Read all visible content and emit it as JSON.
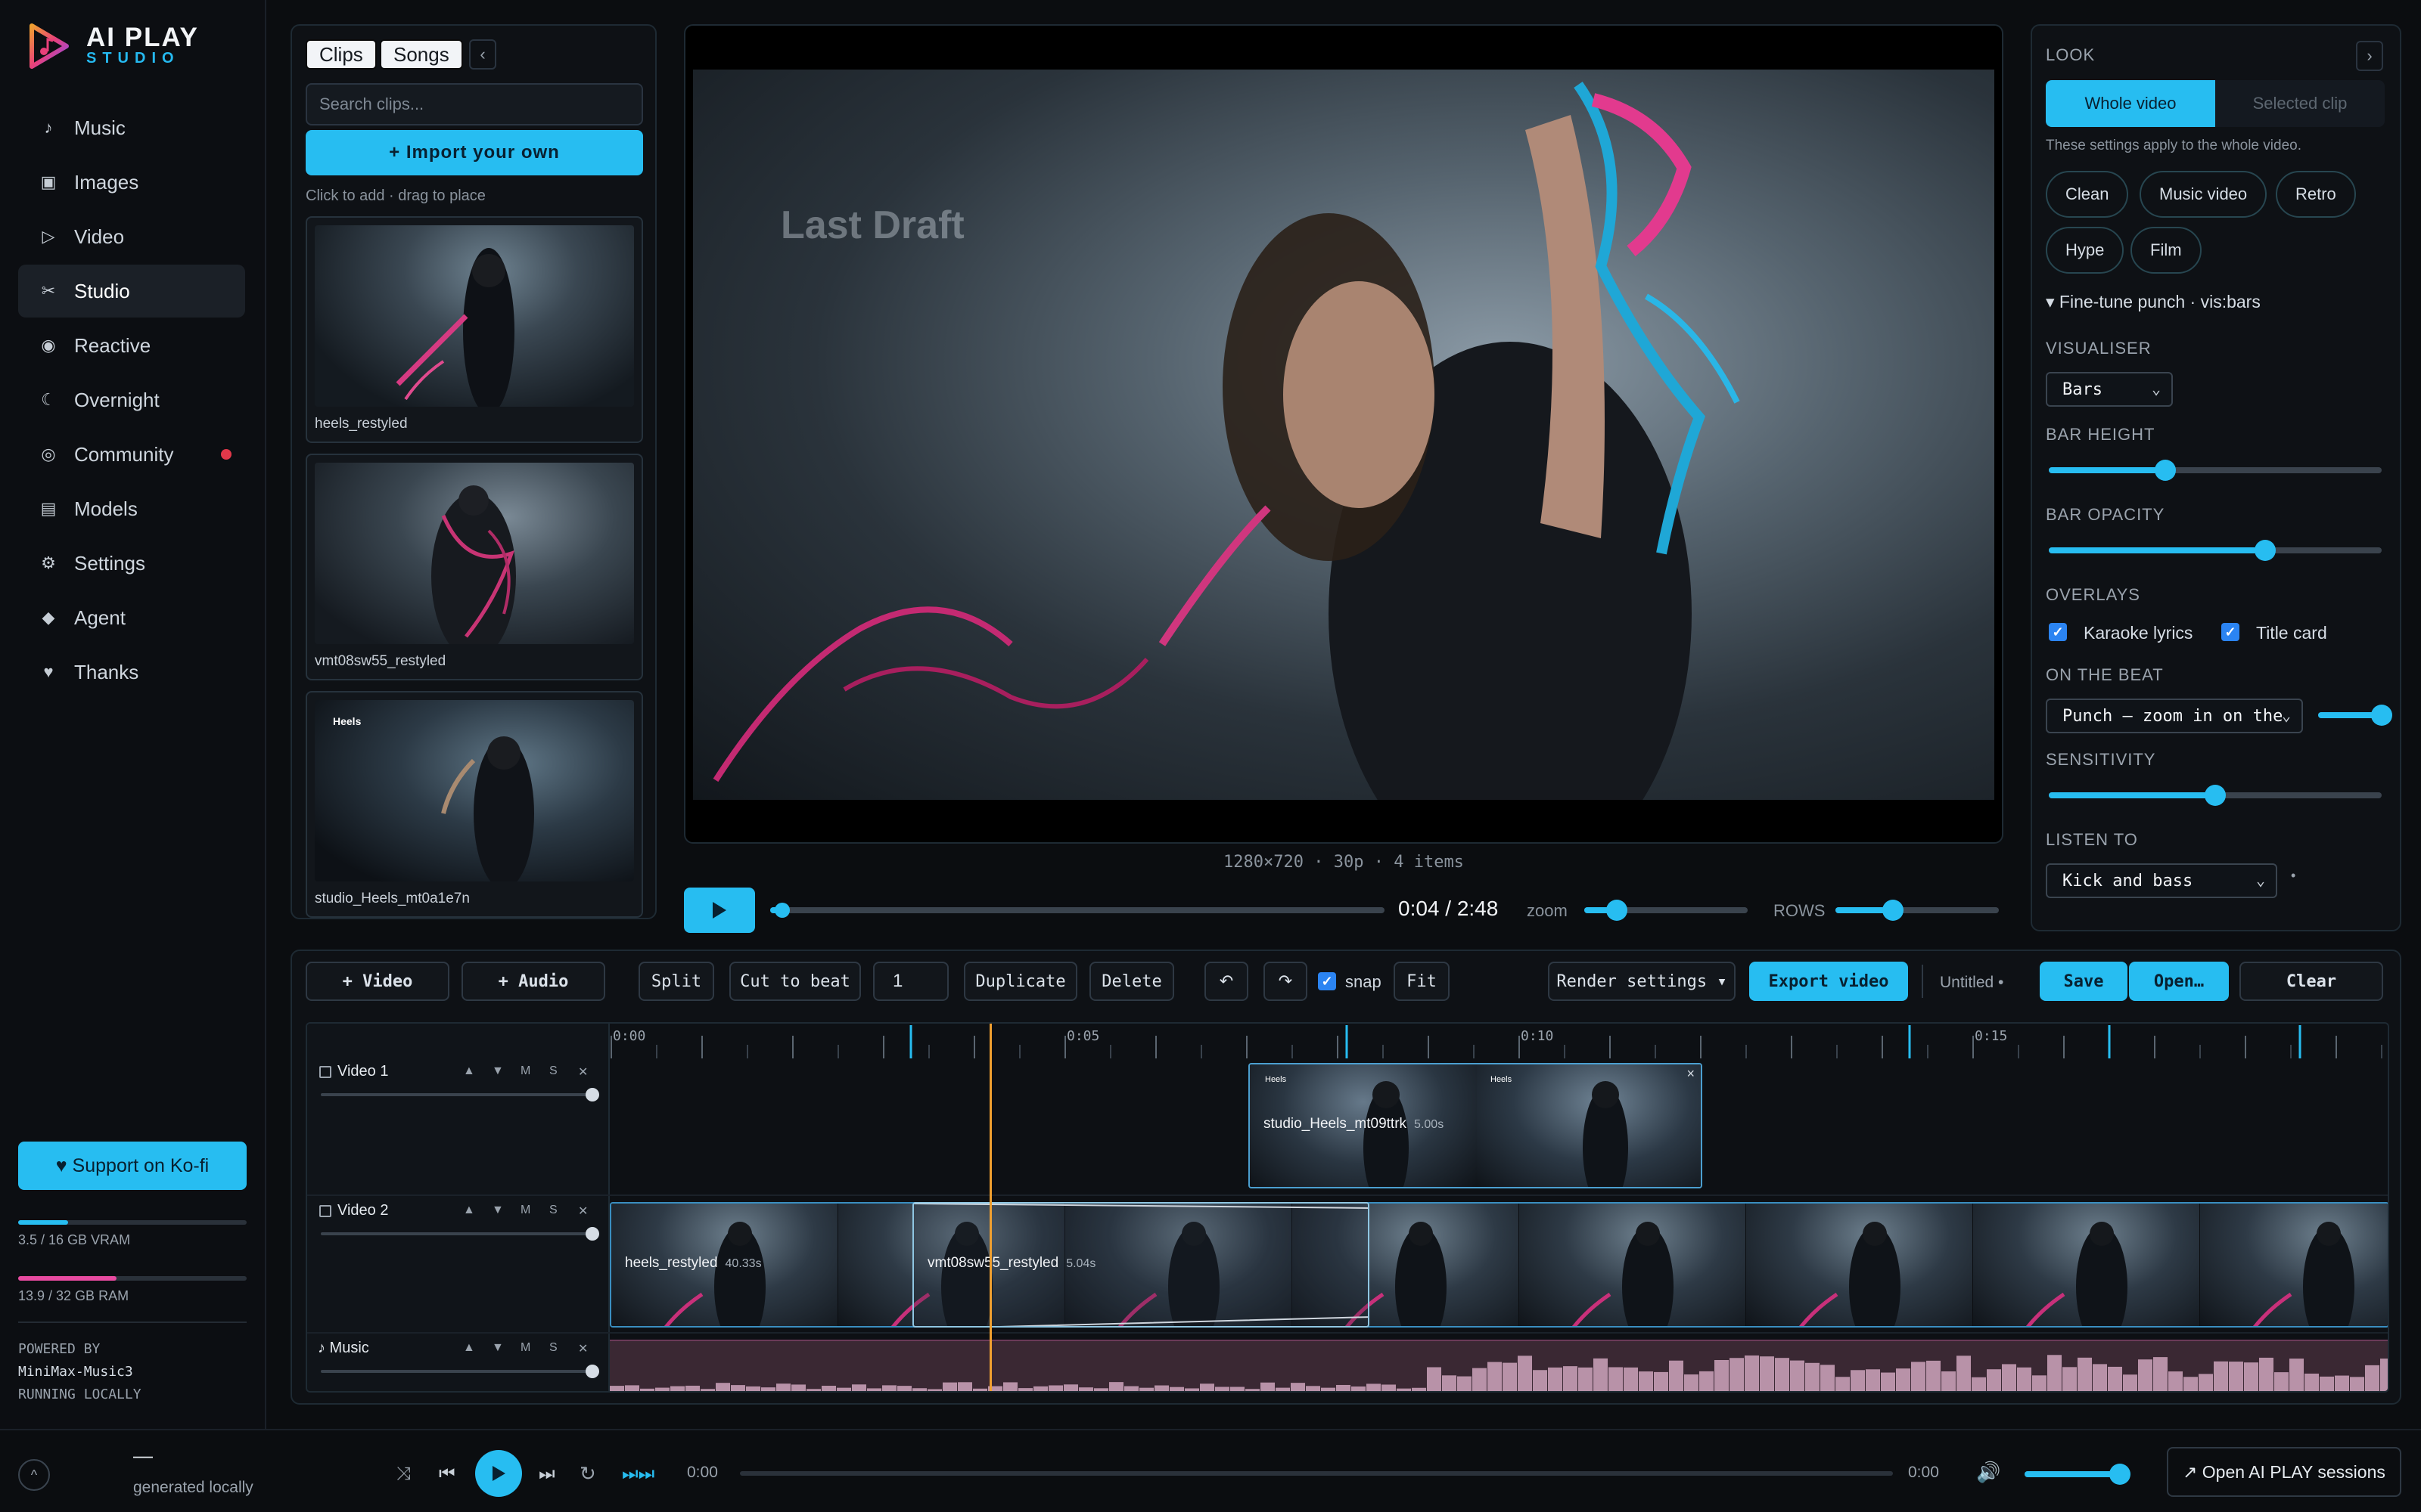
{
  "app": {
    "title_line1": "AI PLAY",
    "title_line2": "STUDIO"
  },
  "sidebar": {
    "items": [
      {
        "label": "Music",
        "icon": "music-note-icon"
      },
      {
        "label": "Images",
        "icon": "image-icon"
      },
      {
        "label": "Video",
        "icon": "play-icon"
      },
      {
        "label": "Studio",
        "icon": "scissors-icon",
        "active": true
      },
      {
        "label": "Reactive",
        "icon": "radio-icon"
      },
      {
        "label": "Overnight",
        "icon": "moon-icon"
      },
      {
        "label": "Community",
        "icon": "globe-icon",
        "badge": true
      },
      {
        "label": "Models",
        "icon": "models-icon"
      },
      {
        "label": "Settings",
        "icon": "gear-icon"
      },
      {
        "label": "Agent",
        "icon": "diamond-icon"
      },
      {
        "label": "Thanks",
        "icon": "heart-icon"
      }
    ],
    "support_label": "♥ Support on Ko-fi",
    "vram_label": "3.5 / 16 GB VRAM",
    "vram_fraction": 0.22,
    "ram_label": "13.9 / 32 GB RAM",
    "ram_fraction": 0.43,
    "powered_line1": "POWERED BY",
    "powered_line2": "MiniMax-Music3",
    "powered_line3": "RUNNING LOCALLY"
  },
  "library": {
    "tab_clips": "Clips",
    "tab_songs": "Songs",
    "collapse": "‹",
    "search_placeholder": "Search clips...",
    "import_label": "+ Import your own",
    "hint": "Click to add · drag to place",
    "clips": [
      {
        "name": "heels_restyled"
      },
      {
        "name": "vmt08sw55_restyled"
      },
      {
        "name": "studio_Heels_mt0a1e7n",
        "overlay": "Heels"
      }
    ]
  },
  "preview": {
    "overlay_title": "Last Draft",
    "resolution_info": "1280×720 · 30p · 4 items",
    "time": "0:04 / 2:48",
    "progress_fraction": 0.02,
    "zoom_label": "zoom",
    "zoom_value": 0.2,
    "rows_label": "ROWS",
    "rows_value": 0.35
  },
  "look": {
    "header": "LOOK",
    "expand": "›",
    "seg_whole": "Whole video",
    "seg_selected": "Selected clip",
    "note": "These settings apply to the whole video.",
    "presets": [
      "Clean",
      "Music video",
      "Retro",
      "Hype",
      "Film"
    ],
    "finetune": "▾ Fine-tune punch · vis:bars",
    "visualiser_label": "VISUALISER",
    "visualiser_value": "Bars",
    "bar_height_label": "BAR HEIGHT",
    "bar_height_value": 0.35,
    "bar_opacity_label": "BAR OPACITY",
    "bar_opacity_value": 0.65,
    "overlays_label": "OVERLAYS",
    "overlay_karaoke": "Karaoke lyrics",
    "overlay_title": "Title card",
    "on_beat_label": "ON THE BEAT",
    "on_beat_value": "Punch — zoom in on the",
    "sensitivity_label": "SENSITIVITY",
    "sensitivity_value": 0.5,
    "listen_label": "LISTEN TO",
    "listen_value": "Kick and bass",
    "listen_dot": "•"
  },
  "toolbar": {
    "add_video": "+ Video",
    "add_audio": "+ Audio",
    "split": "Split",
    "cut_to_beat": "Cut to beat",
    "beat_count": "1",
    "duplicate": "Duplicate",
    "delete": "Delete",
    "undo": "↶",
    "redo": "↷",
    "snap": "snap",
    "fit": "Fit",
    "render_settings": "Render settings ▾",
    "export": "Export video",
    "project": "Untitled •",
    "save": "Save",
    "open": "Open…",
    "clear": "Clear"
  },
  "timeline": {
    "ruler": [
      "0:00",
      "0:05",
      "0:10",
      "0:15"
    ],
    "tracks": [
      {
        "name": "Video 1"
      },
      {
        "name": "Video 2"
      },
      {
        "name": "♪ Music"
      }
    ],
    "track_buttons": [
      "▲",
      "▼",
      "M",
      "S",
      "✕"
    ],
    "clips": {
      "v1": {
        "name": "studio_Heels_mt09ttrk",
        "duration": "5.00s",
        "overlay": "Heels"
      },
      "v2a": {
        "name": "heels_restyled",
        "duration": "40.33s"
      },
      "v2b": {
        "name": "vmt08sw55_restyled",
        "duration": "5.04s"
      }
    }
  },
  "player": {
    "expand": "^",
    "title": "—",
    "subtitle": "generated locally",
    "time_start": "0:00",
    "time_end": "0:00",
    "volume": 0.9,
    "sessions": "↗ Open AI PLAY sessions"
  },
  "colors": {
    "accent": "#27bdf1",
    "pink": "#e84aa0",
    "bg": "#0b0d10"
  }
}
